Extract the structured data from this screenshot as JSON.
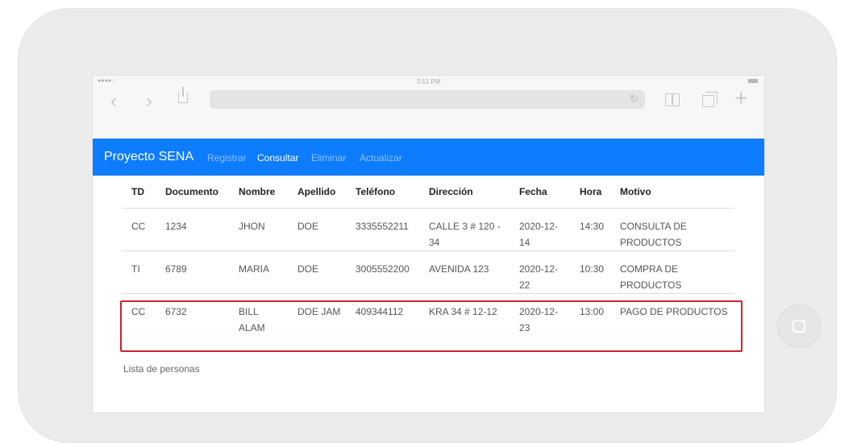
{
  "status": {
    "signal": "●●●●○",
    "time": "3:51 PM"
  },
  "browser": {
    "back_icon": "‹",
    "forward_icon": "›",
    "reload_icon": "↻",
    "new_tab_icon": "+"
  },
  "navbar": {
    "brand": "Proyecto SENA",
    "links": [
      "Registrar",
      "Consultar",
      "Eliminar",
      "Actualizar"
    ],
    "active": "Consultar",
    "bg_color": "#0d7cff"
  },
  "table": {
    "headers": [
      "TD",
      "Documento",
      "Nombre",
      "Apellido",
      "Teléfono",
      "Dirección",
      "Fecha",
      "Hora",
      "Motivo"
    ],
    "rows": [
      [
        "CC",
        "1234",
        "JHON",
        "DOE",
        "3335552211",
        "CALLE 3 # 120 - 34",
        "2020-12-14",
        "14:30",
        "CONSULTA DE PRODUCTOS"
      ],
      [
        "TI",
        "6789",
        "MARIA",
        "DOE",
        "3005552200",
        "AVENIDA 123",
        "2020-12-22",
        "10:30",
        "COMPRA DE PRODUCTOS"
      ],
      [
        "CC",
        "6732",
        "BILL ALAM",
        "DOE JAM",
        "409344112",
        "KRA 34 # 12-12",
        "2020-12-23",
        "13:00",
        "PAGO DE PRODUCTOS"
      ]
    ],
    "caption": "Lista de personas"
  },
  "highlight_color": "#c9252b"
}
